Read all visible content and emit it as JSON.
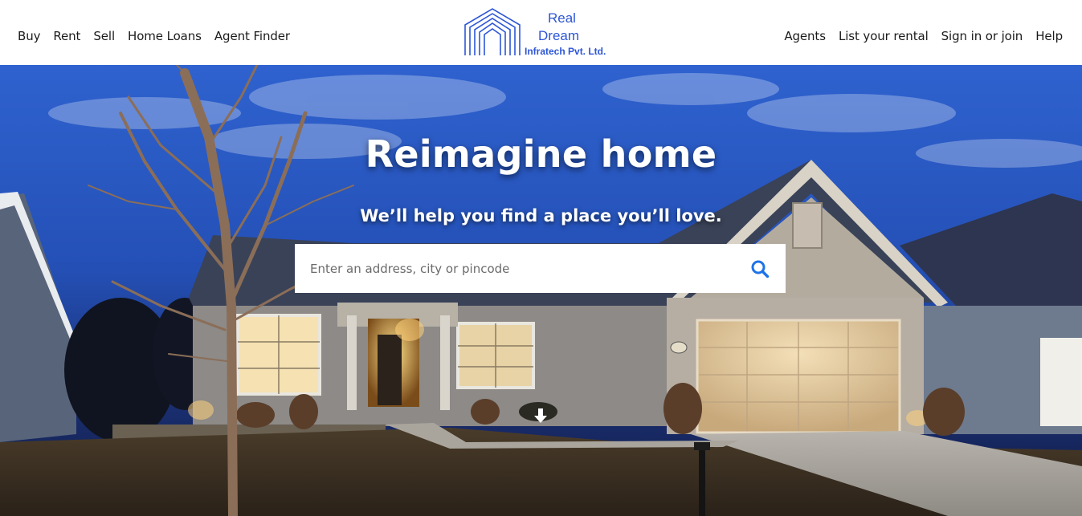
{
  "nav": {
    "left": [
      {
        "label": "Buy"
      },
      {
        "label": "Rent"
      },
      {
        "label": "Sell"
      },
      {
        "label": "Home Loans"
      },
      {
        "label": "Agent Finder"
      }
    ],
    "right": [
      {
        "label": "Agents"
      },
      {
        "label": "List your rental"
      },
      {
        "label": "Sign in or join"
      },
      {
        "label": "Help"
      }
    ]
  },
  "logo": {
    "line1": "Real",
    "line2": "Dream",
    "line3": "Infratech Pvt. Ltd.",
    "icon": "house-outline-icon",
    "color": "#2d56d6"
  },
  "hero": {
    "title": "Reimagine home",
    "subtitle": "We’ll help you find a place you’ll love.",
    "search": {
      "placeholder": "Enter an address, city or pincode",
      "value": "",
      "icon": "search-icon",
      "icon_color": "#1e73e8"
    },
    "scroll_icon": "arrow-down-icon",
    "background_image": "house-at-dusk-photo"
  }
}
